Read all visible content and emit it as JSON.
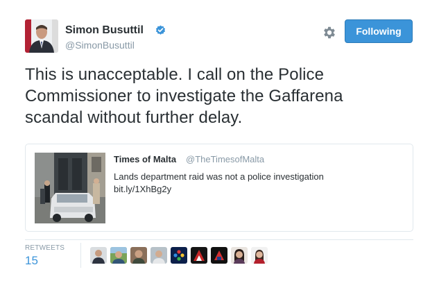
{
  "author": {
    "name": "Simon Busuttil",
    "handle": "@SimonBusuttil",
    "verified": true
  },
  "follow_button": {
    "label": "Following",
    "color": "#3b94d9"
  },
  "tweet": {
    "text": "This is unacceptable. I call on the  Police\nCommissioner to investigate the Gaffarena\nscandal without further delay."
  },
  "quoted": {
    "author": "Times of Malta",
    "handle": "@TheTimesofMalta",
    "text": "Lands department raid was not a police investigation",
    "link": "bit.ly/1XhBg2y"
  },
  "stats": {
    "retweets_label": "RETWEETS",
    "retweets_count": "15"
  },
  "icons": [
    "verified-icon",
    "gear-icon"
  ],
  "retweeter_avatar_count": 9,
  "colors": {
    "accent": "#3b94d9",
    "text": "#292f33",
    "muted": "#8899a6",
    "border": "#e1e8ed"
  }
}
